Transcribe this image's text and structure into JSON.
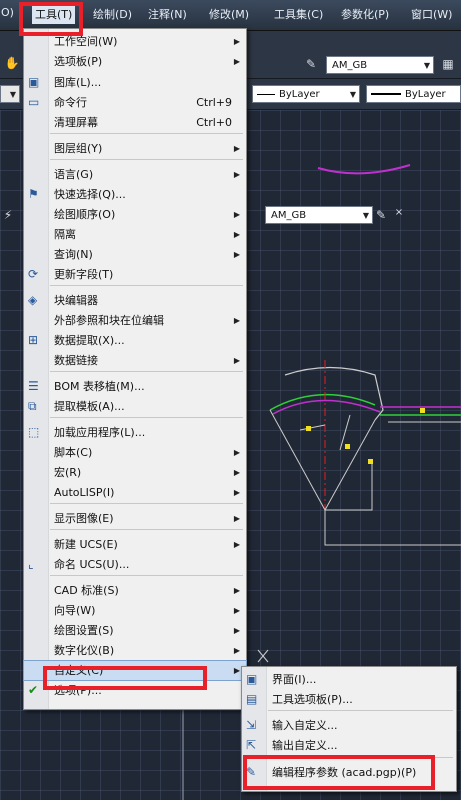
{
  "menubar": {
    "items": [
      "O)",
      "工具(T)",
      "绘制(D)",
      "注释(N)",
      "修改(M)",
      "工具集(C)",
      "参数化(P)",
      "窗口(W)"
    ]
  },
  "toolbar": {
    "style_combo": "AM_GB",
    "layer_combo_1": "ByLayer",
    "layer_combo_2": "ByLayer",
    "style_combo_2": "AM_GB",
    "close_glyph": "×"
  },
  "tools_menu": {
    "items": [
      {
        "label": "工作空间(W)",
        "shortcut": "",
        "submenu": true,
        "icon": ""
      },
      {
        "label": "选项板(P)",
        "shortcut": "",
        "submenu": true,
        "icon": ""
      },
      {
        "label": "图库(L)...",
        "shortcut": "",
        "submenu": false,
        "icon": "gallery-icon"
      },
      {
        "label": "命令行",
        "shortcut": "Ctrl+9",
        "submenu": false,
        "icon": "command-line-icon"
      },
      {
        "label": "清理屏幕",
        "shortcut": "Ctrl+0",
        "submenu": false,
        "icon": ""
      },
      {
        "label": "图层组(Y)",
        "shortcut": "",
        "submenu": true,
        "icon": ""
      },
      {
        "label": "语言(G)",
        "shortcut": "",
        "submenu": true,
        "icon": ""
      },
      {
        "label": "快速选择(Q)...",
        "shortcut": "",
        "submenu": false,
        "icon": "quick-select-icon"
      },
      {
        "label": "绘图顺序(O)",
        "shortcut": "",
        "submenu": true,
        "icon": ""
      },
      {
        "label": "隔离",
        "shortcut": "",
        "submenu": true,
        "icon": ""
      },
      {
        "label": "查询(N)",
        "shortcut": "",
        "submenu": true,
        "icon": ""
      },
      {
        "label": "更新字段(T)",
        "shortcut": "",
        "submenu": false,
        "icon": "update-field-icon"
      },
      {
        "label": "块编辑器",
        "shortcut": "",
        "submenu": false,
        "icon": "block-editor-icon"
      },
      {
        "label": "外部参照和块在位编辑",
        "shortcut": "",
        "submenu": true,
        "icon": ""
      },
      {
        "label": "数据提取(X)...",
        "shortcut": "",
        "submenu": false,
        "icon": "data-extraction-icon"
      },
      {
        "label": "数据链接",
        "shortcut": "",
        "submenu": true,
        "icon": ""
      },
      {
        "label": "BOM 表移植(M)...",
        "shortcut": "",
        "submenu": false,
        "icon": "bom-icon"
      },
      {
        "label": "提取模板(A)...",
        "shortcut": "",
        "submenu": false,
        "icon": "extract-template-icon"
      },
      {
        "label": "加载应用程序(L)...",
        "shortcut": "",
        "submenu": false,
        "icon": "load-app-icon"
      },
      {
        "label": "脚本(C)",
        "shortcut": "",
        "submenu": true,
        "icon": ""
      },
      {
        "label": "宏(R)",
        "shortcut": "",
        "submenu": true,
        "icon": ""
      },
      {
        "label": "AutoLISP(I)",
        "shortcut": "",
        "submenu": true,
        "icon": ""
      },
      {
        "label": "显示图像(E)",
        "shortcut": "",
        "submenu": true,
        "icon": ""
      },
      {
        "label": "新建 UCS(E)",
        "shortcut": "",
        "submenu": true,
        "icon": ""
      },
      {
        "label": "命名 UCS(U)...",
        "shortcut": "",
        "submenu": false,
        "icon": "ucs-icon"
      },
      {
        "label": "CAD 标准(S)",
        "shortcut": "",
        "submenu": true,
        "icon": ""
      },
      {
        "label": "向导(W)",
        "shortcut": "",
        "submenu": true,
        "icon": ""
      },
      {
        "label": "绘图设置(S)",
        "shortcut": "",
        "submenu": true,
        "icon": ""
      },
      {
        "label": "数字化仪(B)",
        "shortcut": "",
        "submenu": true,
        "icon": ""
      },
      {
        "label": "自定义(C)",
        "shortcut": "",
        "submenu": true,
        "icon": ""
      },
      {
        "label": "选项(P)...",
        "shortcut": "",
        "submenu": false,
        "icon": "options-check-icon"
      }
    ]
  },
  "customize_submenu": {
    "items": [
      {
        "label": "界面(I)...",
        "icon": "interface-icon"
      },
      {
        "label": "工具选项板(P)...",
        "icon": "tool-palette-icon"
      },
      {
        "label": "输入自定义...",
        "icon": "import-icon"
      },
      {
        "label": "输出自定义...",
        "icon": "export-icon"
      },
      {
        "label": "编辑程序参数 (acad.pgp)(P)",
        "icon": "edit-pgp-icon"
      }
    ]
  },
  "colors": {
    "highlight_box": "#e8202a",
    "drawing_green": "#2fd03a",
    "drawing_magenta": "#c030d0",
    "drawing_red": "#e02020",
    "drawing_yellow": "#f0e020"
  }
}
